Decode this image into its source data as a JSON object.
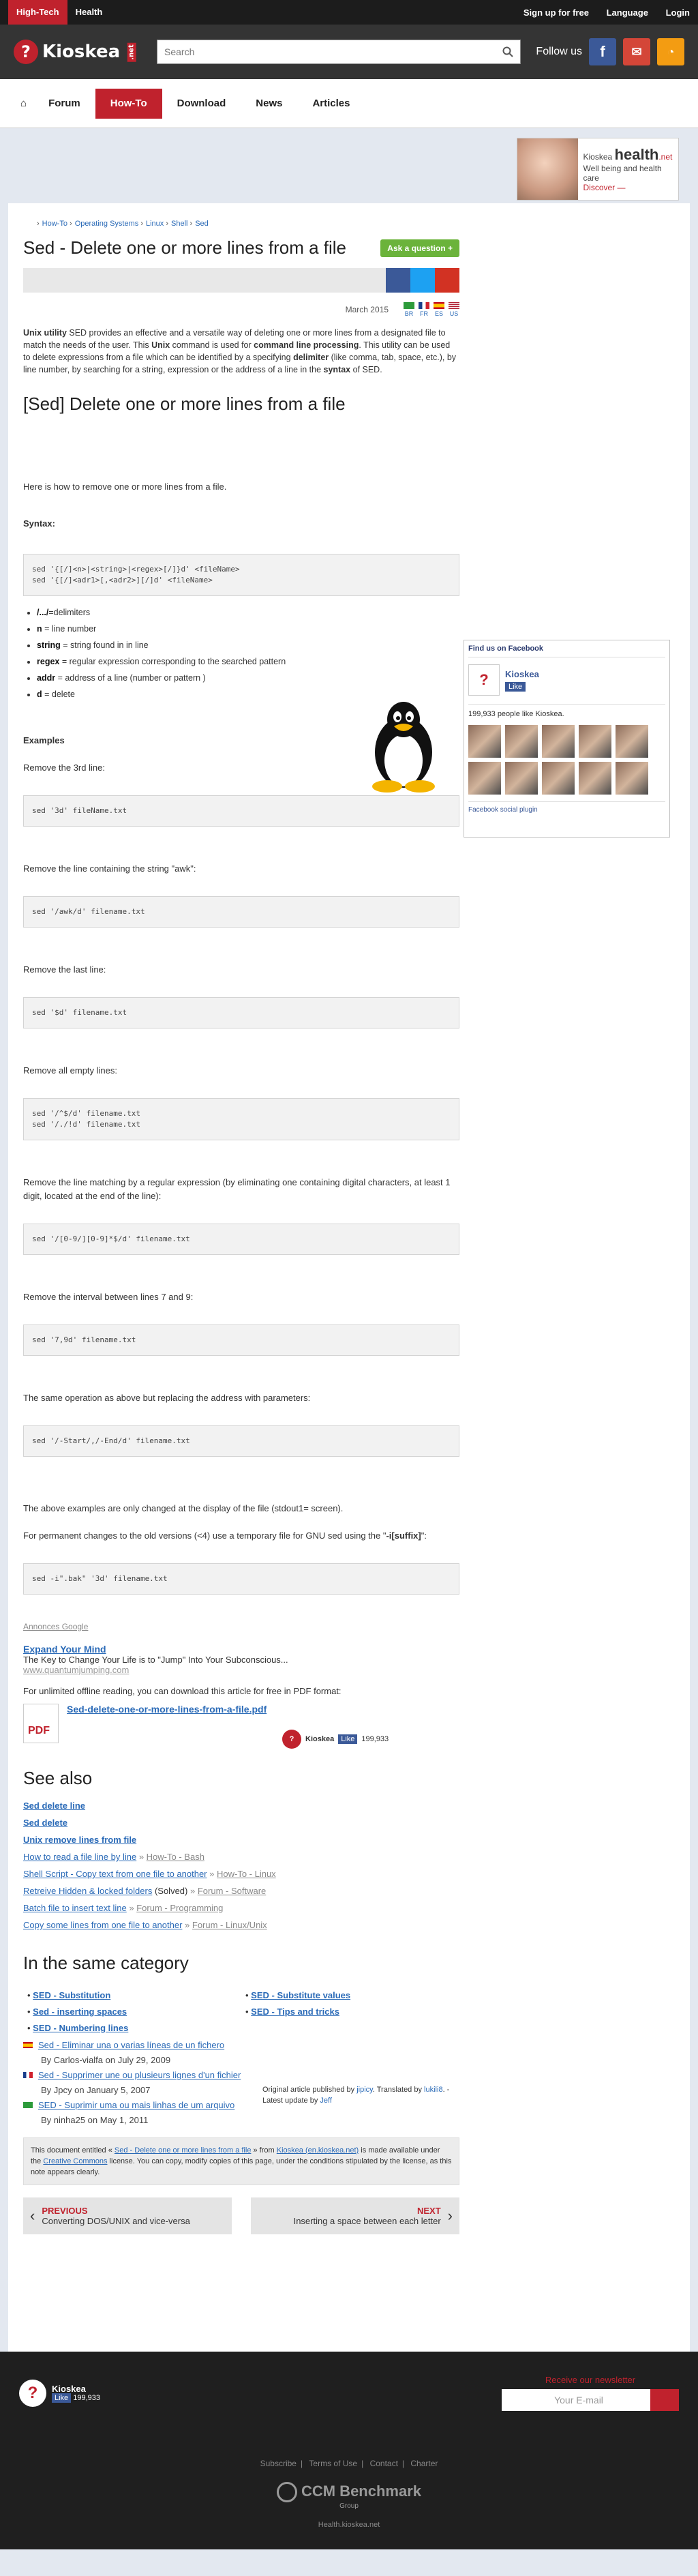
{
  "topbar": {
    "tabs": [
      "High-Tech",
      "Health"
    ],
    "links": [
      "Sign up for free",
      "Language",
      "Login"
    ]
  },
  "header": {
    "logo": "Kioskea",
    "logo_suffix": ".net",
    "search_placeholder": "Search",
    "follow": "Follow us"
  },
  "nav": {
    "items": [
      "Forum",
      "How-To",
      "Download",
      "News",
      "Articles"
    ]
  },
  "health_ad": {
    "brand": "Kioskea",
    "title": "health",
    "suffix": ".net",
    "tagline": "Well being and health care",
    "cta": "Discover —"
  },
  "breadcrumb": [
    "How-To",
    "Operating Systems",
    "Linux",
    "Shell",
    "Sed"
  ],
  "title": "Sed - Delete one or more lines from a file",
  "ask_button": "Ask a question +",
  "date": "March 2015",
  "flags": [
    "BR",
    "FR",
    "ES",
    "US"
  ],
  "intro": {
    "p1": "Unix utility",
    "p2": " SED provides an effective and a versatile way of deleting one or more lines from a designated file to match the needs of the user. This ",
    "p3": "Unix",
    "p4": " command is used for ",
    "p5": "command line processing",
    "p6": ". This utility can be used to delete expressions from a file which can be identified by a specifying ",
    "p7": "delimiter",
    "p8": " (like comma, tab, space, etc.), by line number, by searching for a string, expression or the address of a line in the ",
    "p9": "syntax",
    "p10": " of SED."
  },
  "h2": "[Sed] Delete one or more lines from a file",
  "howto": "Here is how to remove one or more lines from a file.",
  "syntax_label": "Syntax:",
  "syntax_code": "sed '{[/]<n>|<string>|<regex>[/]}d' <fileName>\nsed '{[/]<adr1>[,<adr2>][/]d' <fileName>",
  "defs": [
    {
      "k": "/.../",
      "v": "=delimiters"
    },
    {
      "k": "n",
      "v": " = line number"
    },
    {
      "k": "string",
      "v": " = string found in in line"
    },
    {
      "k": "regex",
      "v": " = regular expression corresponding to the searched pattern"
    },
    {
      "k": "addr",
      "v": " = address of a line (number or pattern )"
    },
    {
      "k": "d",
      "v": " = delete"
    }
  ],
  "examples_label": "Examples",
  "examples": [
    {
      "text": "Remove the 3rd line:",
      "code": "sed '3d' fileName.txt"
    },
    {
      "text": "Remove the line containing the string \"awk\":",
      "code": "sed '/awk/d' filename.txt"
    },
    {
      "text": "Remove the last line:",
      "code": "sed '$d' filename.txt"
    },
    {
      "text": "Remove all empty lines:",
      "code": "sed '/^$/d' filename.txt\nsed '/./!d' filename.txt"
    },
    {
      "text": "Remove the line matching by a regular expression (by eliminating one containing digital characters, at least 1 digit, located at the end of the line):",
      "code": "sed '/[0-9/][0-9]*$/d' filename.txt"
    },
    {
      "text": "Remove the interval between lines 7 and 9:",
      "code": "sed '7,9d' filename.txt"
    },
    {
      "text": "The same operation as above but replacing the address with parameters:",
      "code": "sed '/-Start/,/-End/d' filename.txt"
    }
  ],
  "note1": "The above examples are only changed at the display of the file (stdout1= screen).",
  "note2a": "For permanent changes to the old versions (<4) use a temporary file for GNU sed using the \"",
  "note2b": "-i[suffix]",
  "note2c": "\":",
  "final_code": "sed -i\".bak\" '3d' filename.txt",
  "ad": {
    "label": "Annonces Google",
    "title": "Expand Your Mind",
    "text": "The Key to Change Your Life is to \"Jump\" Into Your Subconscious...",
    "url": "www.quantumjumping.com"
  },
  "pdf": {
    "intro": "For unlimited offline reading, you can download this article for free in PDF format:",
    "link": "Sed-delete-one-or-more-lines-from-a-file.pdf",
    "brand": "Kioskea",
    "like": "Like",
    "count": "199,933"
  },
  "see_also": {
    "title": "See also",
    "bold": [
      "Sed delete line",
      "Sed delete",
      "Unix remove lines from file"
    ],
    "links": [
      {
        "t": "How to read a file line by line",
        "c": "How-To - Bash"
      },
      {
        "t": "Shell Script - Copy text from one file to another",
        "c": "How-To - Linux"
      },
      {
        "t": "Retreive Hidden & locked folders",
        "s": "(Solved)",
        "c": "Forum - Software"
      },
      {
        "t": "Batch file to insert text line",
        "c": "Forum - Programming"
      },
      {
        "t": "Copy some lines from one file to another",
        "c": "Forum - Linux/Unix"
      }
    ]
  },
  "same_cat": {
    "title": "In the same category",
    "left": [
      "SED - Substitution",
      "Sed - inserting spaces",
      "SED - Numbering lines"
    ],
    "right": [
      "SED - Substitute values",
      "SED - Tips and tricks"
    ],
    "intl": [
      {
        "t": "Sed - Eliminar una o varias líneas de un fichero",
        "by": "By Carlos-vialfa on July 29, 2009"
      },
      {
        "t": "Sed - Supprimer une ou plusieurs lignes d'un fichier",
        "by": "By Jpcy on January 5, 2007"
      },
      {
        "t": "SED - Suprimir uma ou mais linhas de um arquivo",
        "by": "By ninha25 on May 1, 2011"
      }
    ]
  },
  "published": {
    "l1a": "Original article published by ",
    "l1b": "jipicy",
    "l1c": ". Translated by ",
    "l1d": "lukili8",
    "l1e": ". - ",
    "l1f": "Latest update by ",
    "l1g": "Jeff"
  },
  "license": {
    "a": "This document entitled « ",
    "b": "Sed - Delete one or more lines from a file",
    "c": " » from ",
    "d": "Kioskea (en.kioskea.net)",
    "e": " is made available under the ",
    "f": "Creative Commons",
    "g": " license. You can copy, modify copies of this page, under the conditions stipulated by the license, as this note appears clearly."
  },
  "pager": {
    "prev_label": "PREVIOUS",
    "prev_title": "Converting DOS/UNIX and vice-versa",
    "next_label": "NEXT",
    "next_title": "Inserting a space between each letter"
  },
  "fb_box": {
    "head": "Find us on Facebook",
    "name": "Kioskea",
    "like": "Like",
    "count": "199,933 people like Kioskea.",
    "plugin": "Facebook social plugin"
  },
  "footer": {
    "brand": "Kioskea",
    "like": "Like",
    "count": "199,933",
    "newsletter": "Receive our newsletter",
    "email_placeholder": "Your E-mail",
    "links": [
      "Subscribe",
      "Terms of Use",
      "Contact",
      "Charter"
    ],
    "ccm": "CCM Benchmark",
    "ccm_sub": "Group",
    "health": "Health.kioskea.net"
  },
  "colors": {
    "accent": "#c0222d",
    "link": "#2a6ab7",
    "fb": "#3b5998",
    "ask": "#6bb33b"
  }
}
